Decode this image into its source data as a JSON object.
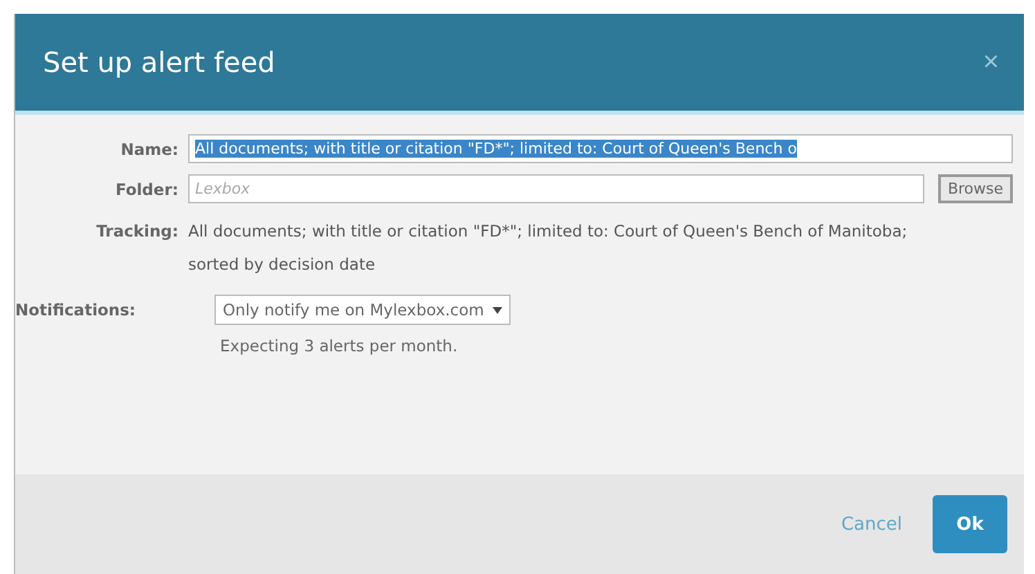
{
  "dialog": {
    "title": "Set up alert feed",
    "close": "×"
  },
  "name": {
    "label": "Name:",
    "value": "All documents; with title or citation \"FD*\"; limited to: Court of Queen's Bench o",
    "selected": true
  },
  "folder": {
    "label": "Folder:",
    "placeholder": "Lexbox",
    "browse": "Browse"
  },
  "tracking": {
    "label": "Tracking:",
    "text": "All documents; with title or citation \"FD*\"; limited to: Court of Queen's Bench of Manitoba; sorted by decision date"
  },
  "notifications": {
    "label": "Notifications:",
    "value": "Only notify me on Mylexbox.com",
    "hint": "Expecting 3 alerts per month."
  },
  "buttons": {
    "cancel": "Cancel",
    "ok": "Ok"
  }
}
